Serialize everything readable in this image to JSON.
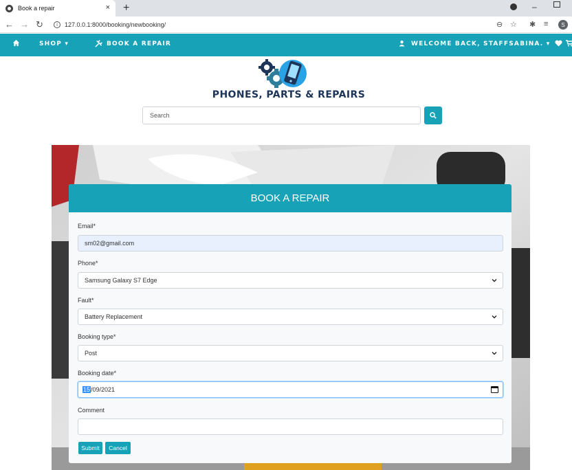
{
  "browser": {
    "tab_title": "Book a repair",
    "tab_close": "×",
    "new_tab": "+",
    "url": "127.0.0.1:8000/booking/newbooking/",
    "profile_initial": "S"
  },
  "navbar": {
    "home_icon": "home-icon",
    "shop_label": "SHOP ▾",
    "book_label": "BOOK A REPAIR",
    "welcome_label": "WELCOME BACK, STAFFSABINA. ▾",
    "cart_icon": "cart-icon",
    "heart_icon": "heart-icon"
  },
  "header": {
    "brand": "PHONES, PARTS & REPAIRS",
    "search_placeholder": "Search"
  },
  "form": {
    "title": "BOOK A REPAIR",
    "email_label": "Email*",
    "email_value": "sm02@gmail.com",
    "phone_label": "Phone*",
    "phone_value": "Samsung Galaxy S7 Edge",
    "fault_label": "Fault*",
    "fault_value": "Battery Replacement",
    "booking_type_label": "Booking type*",
    "booking_type_value": "Post",
    "booking_date_label": "Booking date*",
    "booking_date_day": "15",
    "booking_date_rest": "/09/2021",
    "comment_label": "Comment",
    "comment_value": "",
    "submit_label": "Submit",
    "cancel_label": "Cancel"
  },
  "colors": {
    "accent": "#17a2b8",
    "brand_text": "#1c3558",
    "autofill": "#e8f0fe"
  }
}
